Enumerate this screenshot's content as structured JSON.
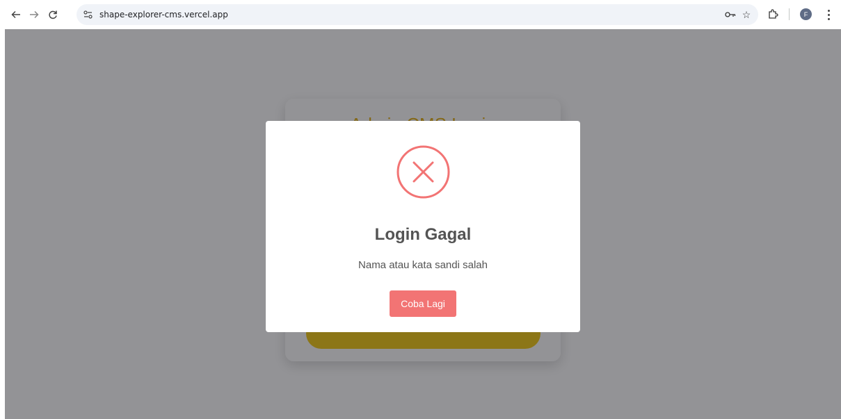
{
  "browser": {
    "url": "shape-explorer-cms.vercel.app",
    "avatar_initial": "F",
    "icons": [
      "back-arrow-icon",
      "forward-arrow-icon",
      "reload-icon",
      "site-info-icon",
      "password-key-icon",
      "bookmark-star-icon",
      "extensions-puzzle-icon",
      "menu-dots-icon"
    ]
  },
  "login_card": {
    "title": "Admin CMS Login",
    "accent_color": "#e0a800"
  },
  "modal": {
    "icon": "error-x-icon",
    "title": "Login Gagal",
    "message": "Nama atau kata sandi salah",
    "button_label": "Coba Lagi",
    "accent_color": "#f27474"
  }
}
